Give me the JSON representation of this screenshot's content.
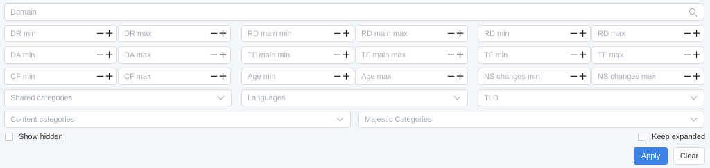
{
  "search": {
    "placeholder": "Domain",
    "icon": "search-icon"
  },
  "stepper": {
    "minus": "−",
    "plus": "+"
  },
  "numeric_fields": {
    "dr_min": "DR min",
    "dr_max": "DR max",
    "rd_main_min": "RD main min",
    "rd_main_max": "RD main max",
    "rd_min": "RD min",
    "rd_max": "RD max",
    "da_min": "DA min",
    "da_max": "DA max",
    "tf_main_min": "TF main min",
    "tf_main_max": "TF main max",
    "tf_min": "TF min",
    "tf_max": "TF max",
    "cf_min": "CF min",
    "cf_max": "CF max",
    "age_min": "Age min",
    "age_max": "Age max",
    "ns_changes_min": "NS changes min",
    "ns_changes_max": "NS changes max"
  },
  "selects": {
    "shared_categories": "Shared categories",
    "languages": "Languages",
    "tld": "TLD",
    "content_categories": "Content categories",
    "majestic_categories": "Majestic Categories"
  },
  "checkboxes": {
    "show_hidden": "Show hidden",
    "keep_expanded": "Keep expanded"
  },
  "buttons": {
    "apply": "Apply",
    "clear": "Clear"
  },
  "colors": {
    "accent": "#3b82e6",
    "border": "#dcdfe4",
    "background": "#f5f6f8"
  }
}
